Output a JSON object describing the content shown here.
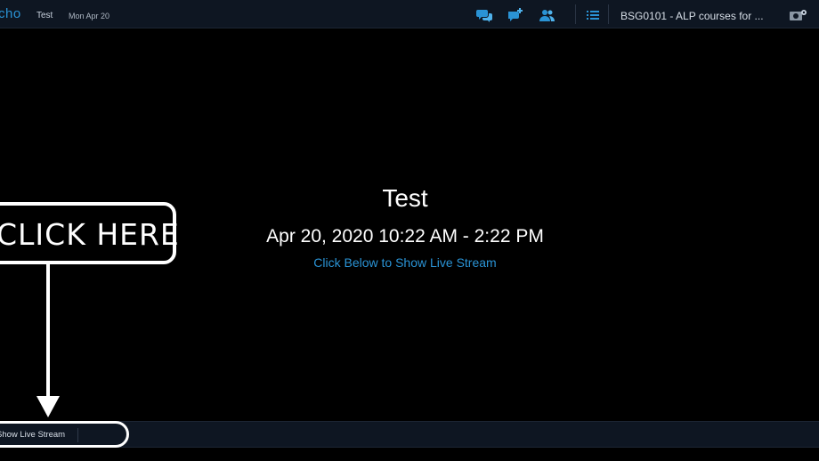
{
  "topbar": {
    "logo": "cho",
    "title": "Test",
    "date": "Mon Apr 20",
    "course": "BSG0101 - ALP courses for ...",
    "icons": {
      "discussions": "chat-bubbles-icon",
      "add_comment": "chat-add-icon",
      "classroom": "people-icon",
      "list": "list-icon",
      "settings": "settings-icon"
    },
    "accent_color": "#2a93d5"
  },
  "event": {
    "title": "Test",
    "time_range": "Apr 20, 2020 10:22 AM - 2:22 PM",
    "hint": "Click Below to Show Live Stream"
  },
  "callout": {
    "text": "CLICK HERE"
  },
  "bottombar": {
    "show_stream_label": "Show Live Stream"
  }
}
